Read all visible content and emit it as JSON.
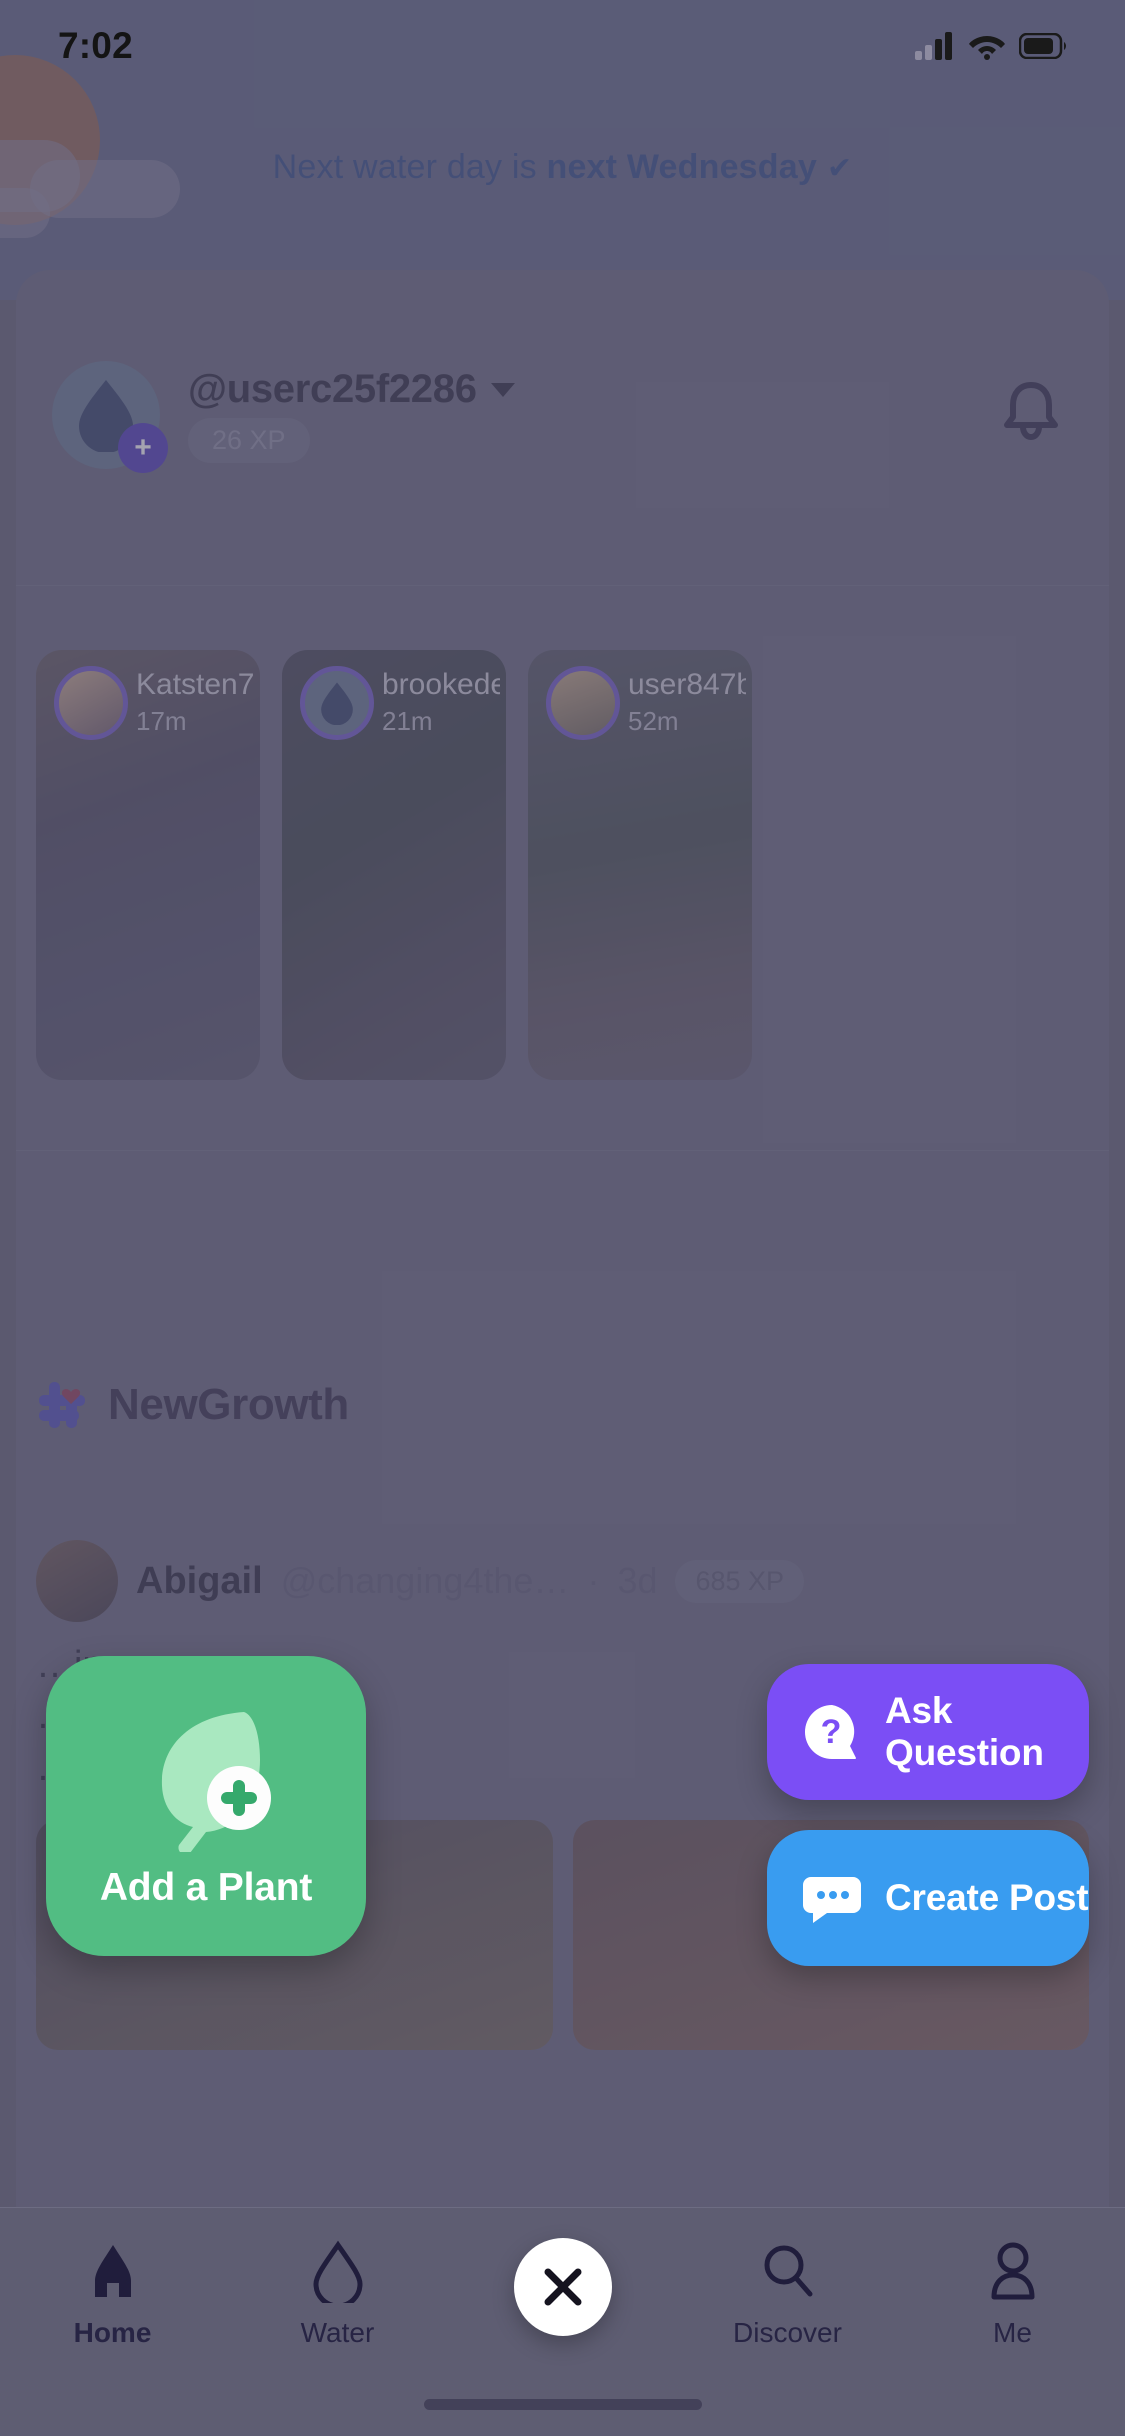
{
  "status_bar": {
    "time": "7:02",
    "icons": [
      "cellular-signal-icon",
      "wifi-icon",
      "battery-icon"
    ]
  },
  "hero": {
    "banner_prefix": "Next water day is ",
    "banner_strong": "next Wednesday",
    "banner_check": "✔",
    "decorations": [
      "sun-shape",
      "cloud-shape"
    ]
  },
  "profile": {
    "username": "@userc25f2286",
    "xp": "26 XP",
    "avatar_icon": "water-drop-leaf-avatar-icon",
    "avatar_badge": "+",
    "dropdown_icon": "chevron-down-icon",
    "bell_icon": "bell-icon"
  },
  "stories": [
    {
      "name": "Katsten7",
      "time": "17m",
      "avatar": "person-avatar-icon"
    },
    {
      "name": "brookede…",
      "time": "21m",
      "avatar": "water-drop-avatar-icon"
    },
    {
      "name": "user847b…",
      "time": "52m",
      "avatar": "dog-avatar-icon"
    }
  ],
  "feed": {
    "section_title": "NewGrowth",
    "section_icon": "hashtag-heart-icon",
    "post": {
      "author": "Abigail",
      "handle": "@changing4the…",
      "separator": "·",
      "age": "3d",
      "xp": "685 XP",
      "body_line1": "…ing",
      "body_line2": "…ve",
      "body_line3": "…n"
    }
  },
  "action_menu": {
    "add_plant": {
      "label": "Add a Plant",
      "icon": "leaf-plus-icon",
      "color": "#52bd83"
    },
    "ask_question": {
      "label": "Ask Question",
      "icon": "question-bubble-icon",
      "color": "#7b4ef5"
    },
    "create_post": {
      "label": "Create Post",
      "icon": "chat-bubble-icon",
      "color": "#399cf0"
    }
  },
  "tabbar": {
    "items": [
      {
        "label": "Home",
        "icon": "home-icon",
        "active": true
      },
      {
        "label": "Water",
        "icon": "water-drop-icon",
        "active": false
      },
      {
        "label": "",
        "icon": "close-icon",
        "active": false
      },
      {
        "label": "Discover",
        "icon": "search-icon",
        "active": false
      },
      {
        "label": "Me",
        "icon": "person-icon",
        "active": false
      }
    ]
  },
  "colors": {
    "accent_purple": "#7b4ef5",
    "accent_green": "#52bd83",
    "accent_blue": "#399cf0",
    "ink": "#221f35"
  }
}
